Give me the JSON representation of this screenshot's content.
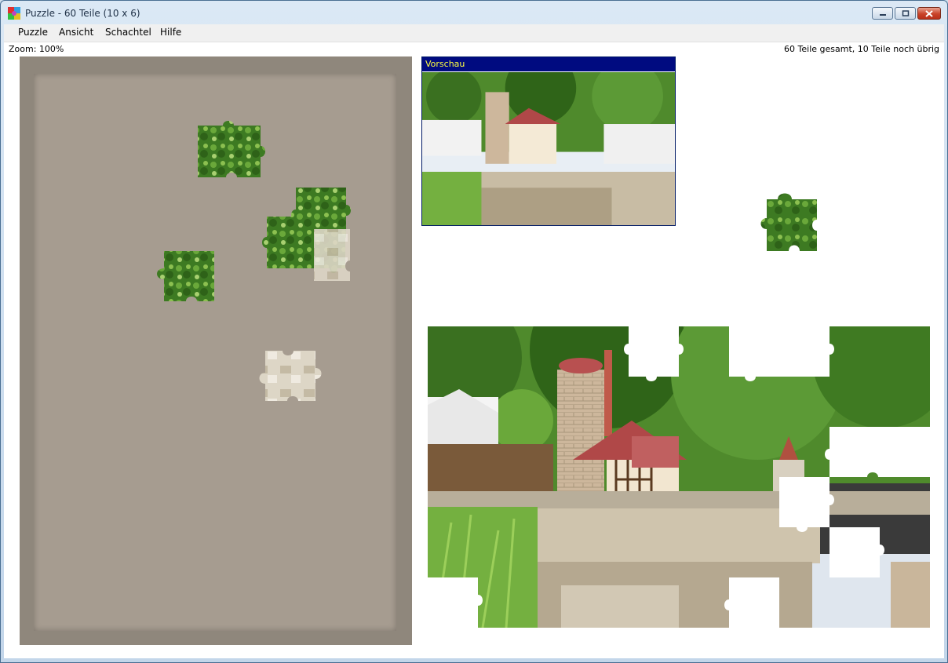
{
  "window": {
    "title": "Puzzle - 60 Teile (10 x 6)",
    "icon": "puzzle-app-icon"
  },
  "menu": {
    "items": [
      "Puzzle",
      "Ansicht",
      "Schachtel",
      "Hilfe"
    ]
  },
  "status": {
    "zoom": "Zoom: 100%",
    "count": "60 Teile gesamt, 10 Teile noch übrig"
  },
  "preview": {
    "title": "Vorschau"
  },
  "colors": {
    "title_blue": "#000b80",
    "title_text": "#ffff40",
    "box": "#a69c90",
    "foliage": "#3f7a22",
    "stone": "#cfc4ad"
  },
  "puzzle": {
    "total_pieces": 60,
    "remaining_pieces": 10,
    "columns": 10,
    "rows": 6
  }
}
